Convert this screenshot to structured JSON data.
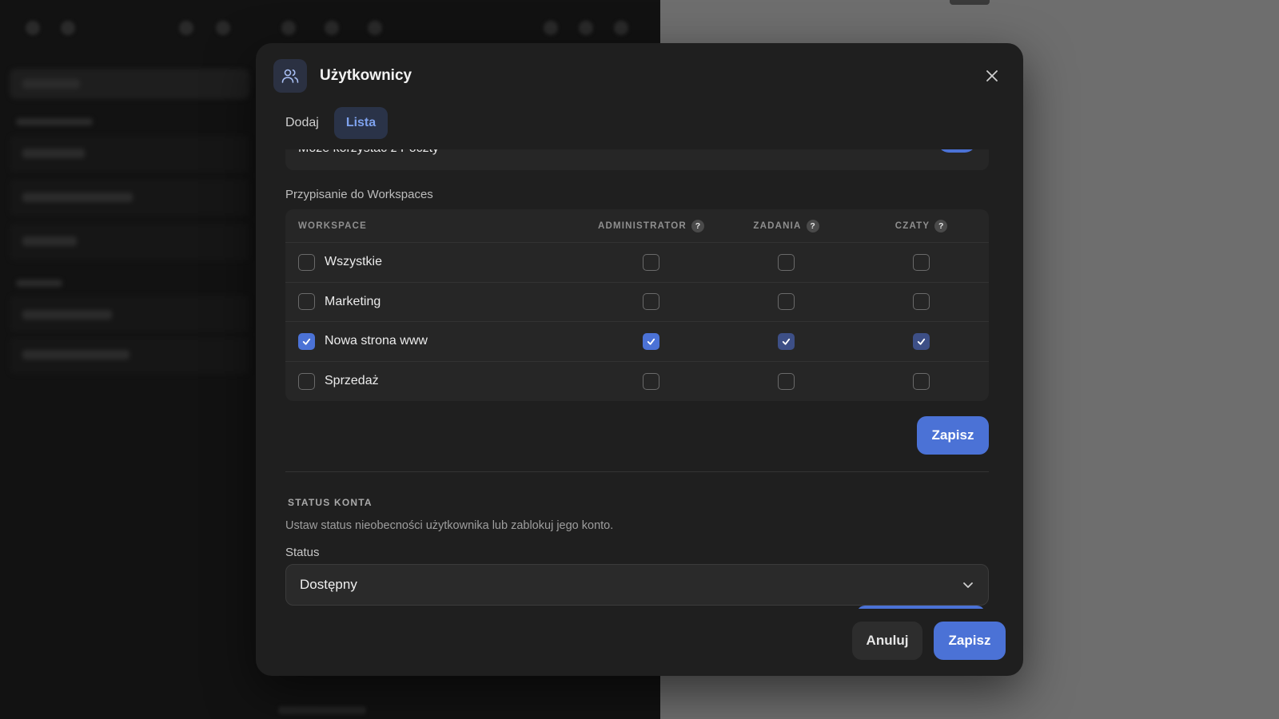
{
  "modal": {
    "title": "Użytkownicy",
    "tabs": [
      {
        "label": "Dodaj",
        "active": false
      },
      {
        "label": "Lista",
        "active": true
      }
    ]
  },
  "permission": {
    "label": "Może korzystać z Poczty",
    "enabled": true
  },
  "workspaces": {
    "section_label": "Przypisanie do Workspaces",
    "columns": {
      "workspace": "WORKSPACE",
      "admin": "ADMINISTRATOR",
      "tasks": "ZADANIA",
      "chats": "CZATY",
      "help": "?"
    },
    "rows": [
      {
        "name": "Wszystkie",
        "checked": false,
        "admin": false,
        "tasks": false,
        "chats": false
      },
      {
        "name": "Marketing",
        "checked": false,
        "admin": false,
        "tasks": false,
        "chats": false
      },
      {
        "name": "Nowa strona www",
        "checked": true,
        "admin": true,
        "tasks": true,
        "chats": true
      },
      {
        "name": "Sprzedaż",
        "checked": false,
        "admin": false,
        "tasks": false,
        "chats": false
      }
    ],
    "save_label": "Zapisz"
  },
  "account_status": {
    "heading": "STATUS KONTA",
    "description": "Ustaw status nieobecności użytkownika lub zablokuj jego konto.",
    "field_label": "Status",
    "selected": "Dostępny"
  },
  "footer": {
    "cancel_label": "Anuluj",
    "save_label": "Zapisz"
  },
  "colors": {
    "accent": "#4b72d6",
    "accent_dim": "#3d4f86",
    "modal_bg": "#1f1f1f",
    "card_bg": "#262626"
  }
}
